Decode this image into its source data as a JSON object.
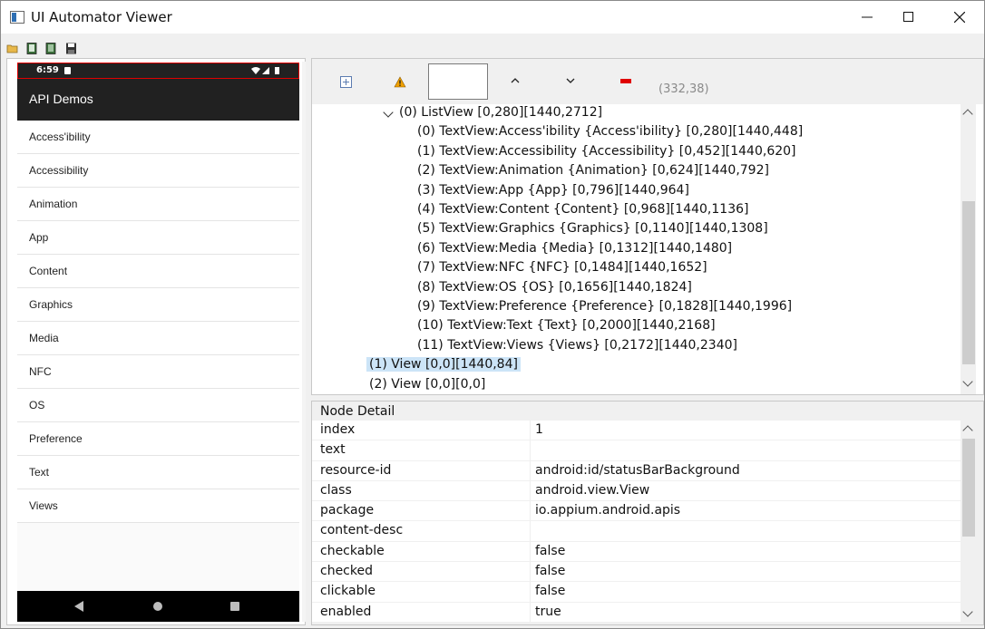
{
  "window": {
    "title": "UI Automator Viewer"
  },
  "toolbar": {
    "icons": [
      "open-folder-icon",
      "device-screenshot-icon",
      "device-screenshot-compressed-icon",
      "save-icon"
    ]
  },
  "device": {
    "status_time": "6:59",
    "app_title": "API Demos",
    "list_items": [
      "Access'ibility",
      "Accessibility",
      "Animation",
      "App",
      "Content",
      "Graphics",
      "Media",
      "NFC",
      "OS",
      "Preference",
      "Text",
      "Views"
    ]
  },
  "tree_toolbar": {
    "coords": "(332,38)"
  },
  "tree": {
    "rows": [
      {
        "text": "(0) ListView [0,280][1440,2712]"
      },
      {
        "text": "(0) TextView:Access'ibility {Access'ibility} [0,280][1440,448]"
      },
      {
        "text": "(1) TextView:Accessibility {Accessibility} [0,452][1440,620]"
      },
      {
        "text": "(2) TextView:Animation {Animation} [0,624][1440,792]"
      },
      {
        "text": "(3) TextView:App {App} [0,796][1440,964]"
      },
      {
        "text": "(4) TextView:Content {Content} [0,968][1440,1136]"
      },
      {
        "text": "(5) TextView:Graphics {Graphics} [0,1140][1440,1308]"
      },
      {
        "text": "(6) TextView:Media {Media} [0,1312][1440,1480]"
      },
      {
        "text": "(7) TextView:NFC {NFC} [0,1484][1440,1652]"
      },
      {
        "text": "(8) TextView:OS {OS} [0,1656][1440,1824]"
      },
      {
        "text": "(9) TextView:Preference {Preference} [0,1828][1440,1996]"
      },
      {
        "text": "(10) TextView:Text {Text} [0,2000][1440,2168]"
      },
      {
        "text": "(11) TextView:Views {Views} [0,2172][1440,2340]"
      },
      {
        "text": "(1) View [0,0][1440,84]",
        "selected": true
      },
      {
        "text": "(2) View [0,0][0,0]"
      }
    ]
  },
  "node_detail": {
    "title": "Node Detail",
    "rows": [
      {
        "key": "index",
        "value": "1"
      },
      {
        "key": "text",
        "value": ""
      },
      {
        "key": "resource-id",
        "value": "android:id/statusBarBackground"
      },
      {
        "key": "class",
        "value": "android.view.View"
      },
      {
        "key": "package",
        "value": "io.appium.android.apis"
      },
      {
        "key": "content-desc",
        "value": ""
      },
      {
        "key": "checkable",
        "value": "false"
      },
      {
        "key": "checked",
        "value": "false"
      },
      {
        "key": "clickable",
        "value": "false"
      },
      {
        "key": "enabled",
        "value": "true"
      }
    ]
  },
  "colors": {
    "selection": "#cce4f7",
    "status_outline": "#e00000",
    "action_bar": "#212121",
    "warning": "#f0a000",
    "remove": "#e00000"
  }
}
